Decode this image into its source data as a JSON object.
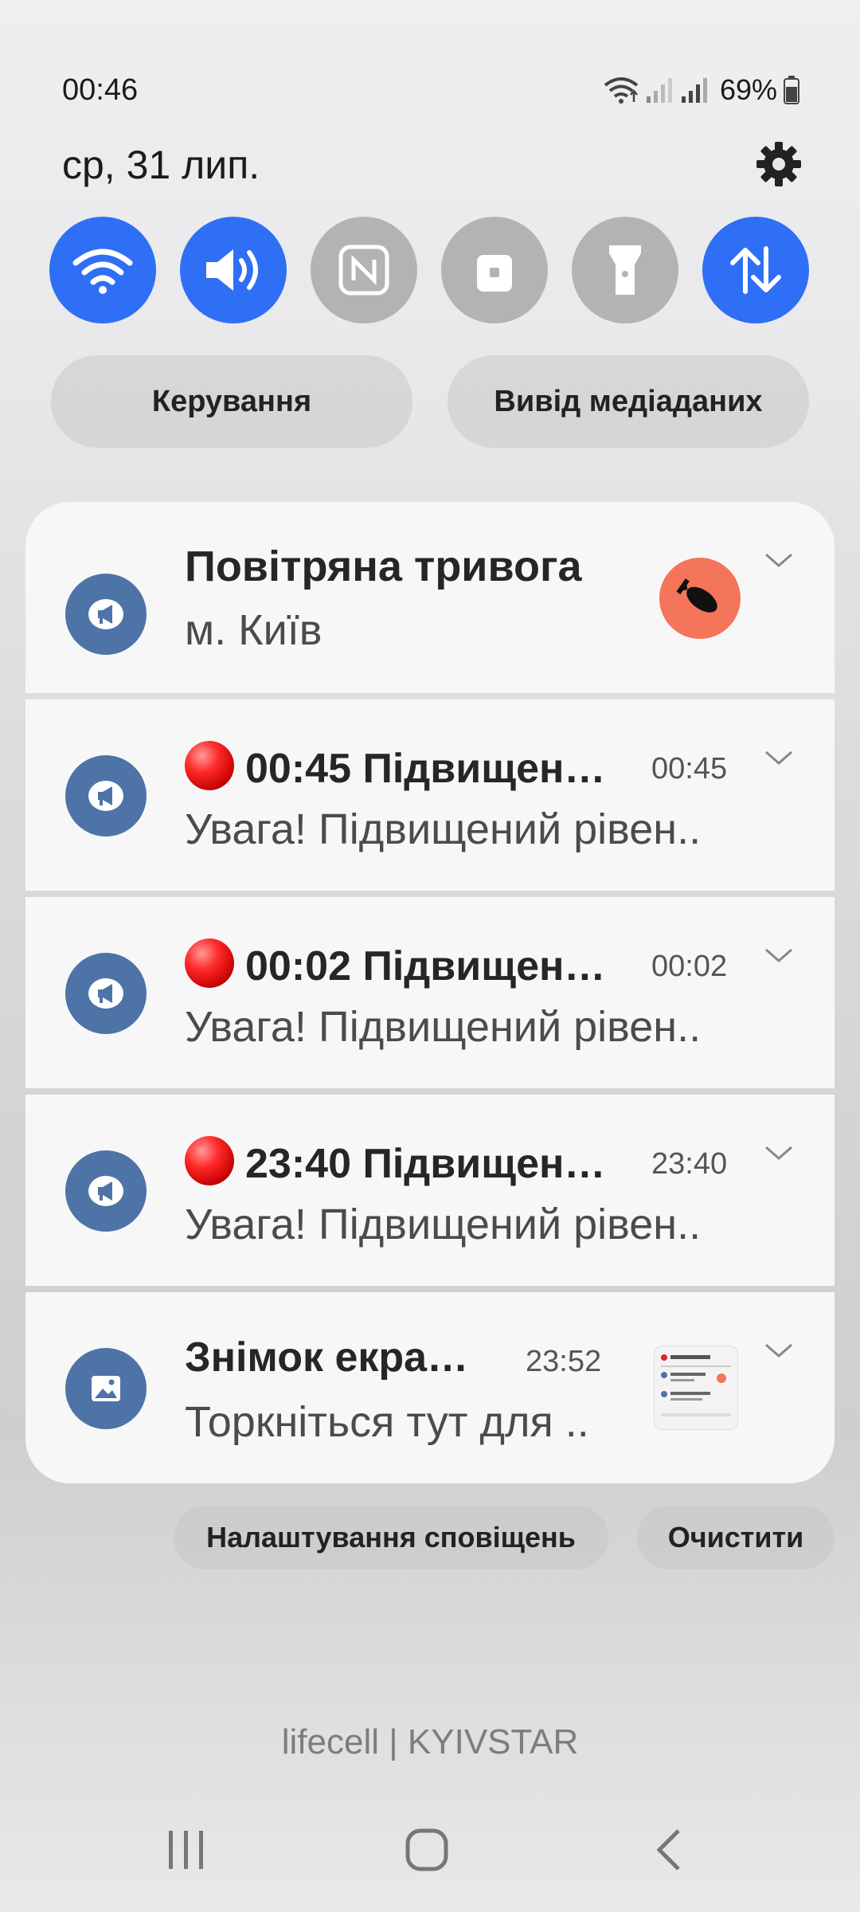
{
  "status_bar": {
    "time": "00:46",
    "battery": "69%"
  },
  "header": {
    "date": "ср, 31 лип."
  },
  "quick_settings": [
    {
      "name": "wifi",
      "state": "on",
      "icon": "wifi-icon"
    },
    {
      "name": "sound",
      "state": "on",
      "icon": "speaker-icon"
    },
    {
      "name": "nfc",
      "state": "off",
      "icon": "nfc-icon"
    },
    {
      "name": "lock",
      "state": "off",
      "icon": "lock-icon"
    },
    {
      "name": "flashlight",
      "state": "off",
      "icon": "flashlight-icon"
    },
    {
      "name": "mobile data",
      "state": "on",
      "icon": "data-arrows-icon"
    }
  ],
  "pills": {
    "control": "Керування",
    "media_output": "Вивід медіаданих"
  },
  "notifications": [
    {
      "title": "Повітряна тривога",
      "body": "м. Київ"
    },
    {
      "title": "00:45 Підвищен…",
      "time": "00:45",
      "body": "Увага! Підвищений рівен.."
    },
    {
      "title": "00:02 Підвищен…",
      "time": "00:02",
      "body": "Увага! Підвищений рівен.."
    },
    {
      "title": "23:40 Підвищен…",
      "time": "23:40",
      "body": "Увага! Підвищений рівен.."
    },
    {
      "title": "Знімок екра…",
      "time": "23:52",
      "body": "Торкніться тут для .."
    }
  ],
  "footer": {
    "settings": "Налаштування сповіщень",
    "clear": "Очистити"
  },
  "carrier": "lifecell | KYIVSTAR",
  "colors": {
    "accent": "#2f6ff5",
    "app_icon": "#4e73a6",
    "alert_badge": "#f4755a"
  }
}
